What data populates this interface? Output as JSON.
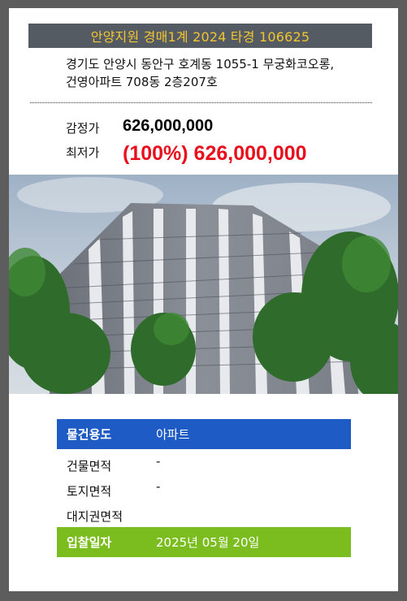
{
  "title": "안양지원 경매1계 2024 타경 106625",
  "address": [
    "경기도 안양시 동안구 호계동 1055-1 무궁화코오롱,",
    "건영아파트 708동 2층207호"
  ],
  "appraisal": {
    "label": "감정가",
    "value": "626,000,000"
  },
  "minimum": {
    "label": "최저가",
    "value": "(100%) 626,000,000"
  },
  "details": [
    {
      "label": "물건용도",
      "value": "아파트"
    },
    {
      "label": "건물면적",
      "value": "-"
    },
    {
      "label": "토지면적",
      "value": "-"
    },
    {
      "label": "대지권면적",
      "value": ""
    },
    {
      "label": "입찰일자",
      "value": "2025년 05월 20일"
    }
  ],
  "colors": {
    "title_bg": "#555b63",
    "title_text": "#f2c531",
    "blue": "#1f5bc4",
    "green": "#7bbd1e",
    "min_price": "#e8101c"
  }
}
